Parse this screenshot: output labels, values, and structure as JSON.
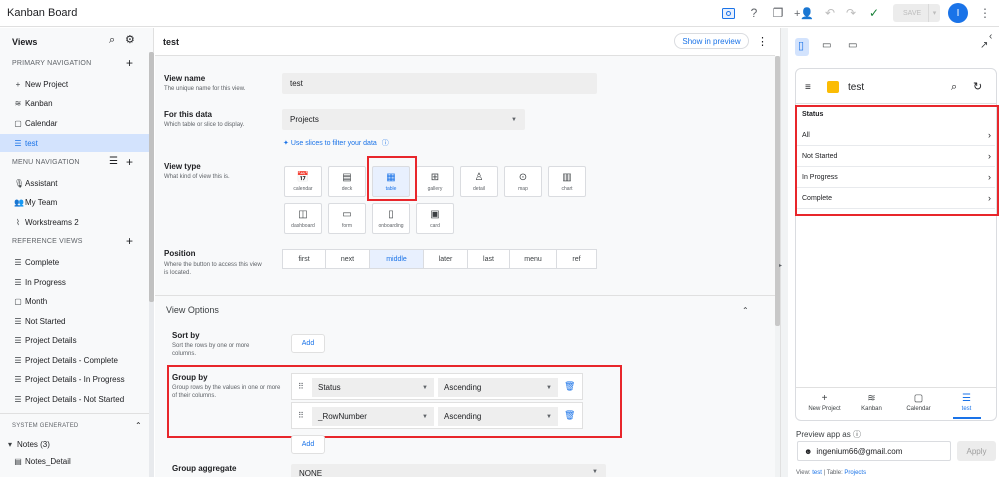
{
  "app": {
    "title": "Kanban Board",
    "save_label": "SAVE",
    "avatar_initial": "I"
  },
  "sidebar": {
    "title": "Views",
    "primary_label": "PRIMARY NAVIGATION",
    "primary_items": [
      {
        "label": "New Project",
        "icon": "+"
      },
      {
        "label": "Kanban",
        "icon": "≋"
      },
      {
        "label": "Calendar",
        "icon": "▢"
      },
      {
        "label": "test",
        "icon": "☰"
      }
    ],
    "menu_label": "MENU NAVIGATION",
    "menu_items": [
      {
        "label": "Assistant",
        "icon": "🎙"
      },
      {
        "label": "My Team",
        "icon": "👥"
      },
      {
        "label": "Workstreams 2",
        "icon": "⌇"
      }
    ],
    "reference_label": "REFERENCE VIEWS",
    "reference_items": [
      {
        "label": "Complete",
        "icon": "☰"
      },
      {
        "label": "In Progress",
        "icon": "☰"
      },
      {
        "label": "Month",
        "icon": "▢"
      },
      {
        "label": "Not Started",
        "icon": "☰"
      },
      {
        "label": "Project Details",
        "icon": "☰"
      },
      {
        "label": "Project Details - Complete",
        "icon": "☰"
      },
      {
        "label": "Project Details - In Progress",
        "icon": "☰"
      },
      {
        "label": "Project Details - Not Started",
        "icon": "☰"
      }
    ],
    "system_label": "SYSTEM GENERATED",
    "notes_label": "Notes (3)",
    "notes_detail": "Notes_Detail"
  },
  "main": {
    "title": "test",
    "show_preview": "Show in preview",
    "view_name": {
      "label": "View name",
      "desc": "The unique name for this view.",
      "value": "test"
    },
    "for_data": {
      "label": "For this data",
      "desc": "Which table or slice to display.",
      "value": "Projects"
    },
    "slices_link": "Use slices to filter your data",
    "view_type": {
      "label": "View type",
      "desc": "What kind of view this is.",
      "options": [
        {
          "label": "calendar",
          "glyph": "📅"
        },
        {
          "label": "deck",
          "glyph": "▤"
        },
        {
          "label": "table",
          "glyph": "▦"
        },
        {
          "label": "gallery",
          "glyph": "⊞"
        },
        {
          "label": "detail",
          "glyph": "♙"
        },
        {
          "label": "map",
          "glyph": "⊙"
        },
        {
          "label": "chart",
          "glyph": "▥"
        },
        {
          "label": "dashboard",
          "glyph": "◫"
        },
        {
          "label": "form",
          "glyph": "▭"
        },
        {
          "label": "onboarding",
          "glyph": "▯"
        },
        {
          "label": "card",
          "glyph": "▣"
        }
      ],
      "selected": "table"
    },
    "position": {
      "label": "Position",
      "desc": "Where the button to access this view is located.",
      "options": [
        "first",
        "next",
        "middle",
        "later",
        "last",
        "menu",
        "ref"
      ],
      "selected": "middle"
    },
    "view_options_title": "View Options",
    "sort_by": {
      "label": "Sort by",
      "desc": "Sort the rows by one or more columns.",
      "add": "Add"
    },
    "group_by": {
      "label": "Group by",
      "desc": "Group rows by the values in one or more of their columns.",
      "rows": [
        {
          "column": "Status",
          "order": "Ascending"
        },
        {
          "column": "_RowNumber",
          "order": "Ascending"
        }
      ],
      "add": "Add"
    },
    "group_aggregate": {
      "label": "Group aggregate",
      "value": "NONE"
    }
  },
  "preview": {
    "app_title": "test",
    "header": "Status",
    "rows": [
      "All",
      "Not Started",
      "In Progress",
      "Complete"
    ],
    "tabs": [
      {
        "label": "New Project",
        "glyph": "+"
      },
      {
        "label": "Kanban",
        "glyph": "≋"
      },
      {
        "label": "Calendar",
        "glyph": "▢"
      },
      {
        "label": "test",
        "glyph": "☰"
      }
    ],
    "selected_tab": "test",
    "preview_as": "Preview app as",
    "email": "ingenium66@gmail.com",
    "apply": "Apply",
    "footer_view_prefix": "View:",
    "footer_view": "test",
    "footer_table_prefix": "Table:",
    "footer_table": "Projects"
  },
  "colors": {
    "accent": "#1a73e8",
    "highlight": "#e8262b",
    "selected_bg": "#d3e3fd"
  }
}
